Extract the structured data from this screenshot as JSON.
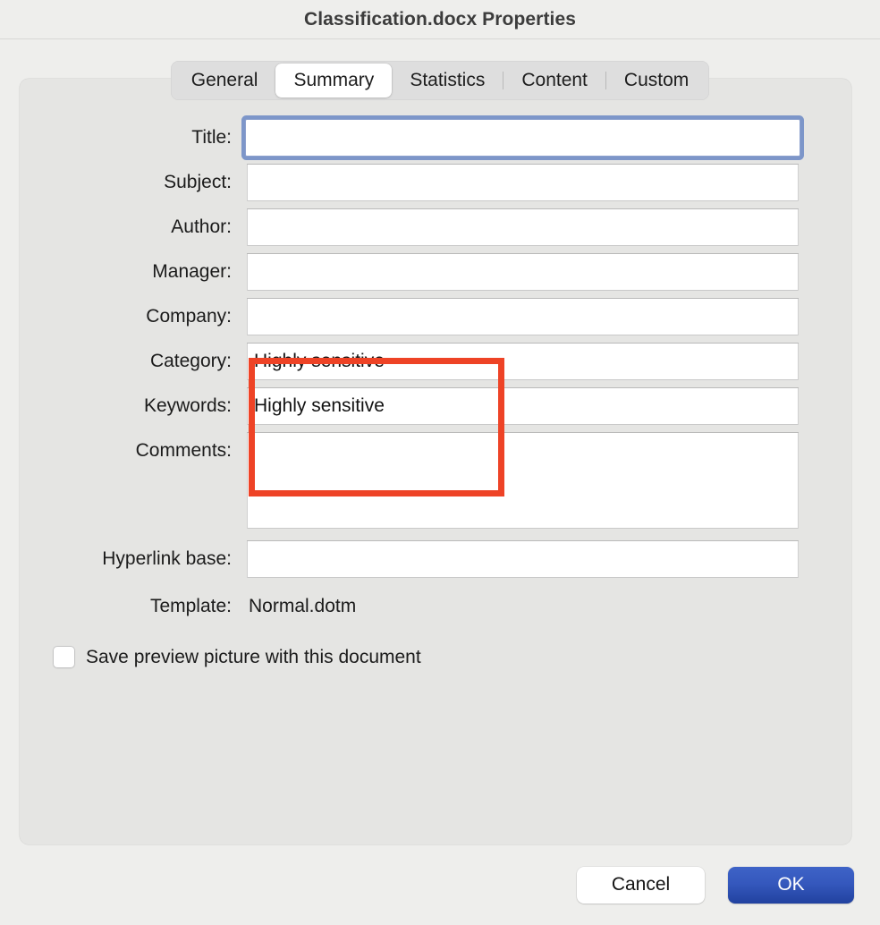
{
  "window": {
    "title": "Classification.docx Properties"
  },
  "tabs": [
    {
      "label": "General",
      "active": false
    },
    {
      "label": "Summary",
      "active": true
    },
    {
      "label": "Statistics",
      "active": false
    },
    {
      "label": "Content",
      "active": false
    },
    {
      "label": "Custom",
      "active": false
    }
  ],
  "summary": {
    "title": {
      "label": "Title:",
      "value": "",
      "placeholder": ""
    },
    "subject": {
      "label": "Subject:",
      "value": "",
      "placeholder": ""
    },
    "author": {
      "label": "Author:",
      "value": "",
      "placeholder": ""
    },
    "manager": {
      "label": "Manager:",
      "value": "",
      "placeholder": ""
    },
    "company": {
      "label": "Company:",
      "value": "",
      "placeholder": ""
    },
    "category": {
      "label": "Category:",
      "value": "Highly sensitive",
      "placeholder": ""
    },
    "keywords": {
      "label": "Keywords:",
      "value": "Highly sensitive",
      "placeholder": ""
    },
    "comments": {
      "label": "Comments:",
      "value": "",
      "placeholder": ""
    },
    "hyperlink_base": {
      "label": "Hyperlink base:",
      "value": "",
      "placeholder": ""
    },
    "template": {
      "label": "Template:",
      "value": "Normal.dotm"
    },
    "save_preview": {
      "label": "Save preview picture with this document",
      "checked": false
    }
  },
  "footer": {
    "cancel_label": "Cancel",
    "ok_label": "OK"
  },
  "annotation": {
    "color": "#ee4326",
    "name": "highlight-rectangle"
  },
  "colors": {
    "window_background": "#eeeeec",
    "panel_background": "#e5e5e3",
    "tabbar_background": "#dedede",
    "focus_ring": "#7d96c9",
    "ok_button": "#3558bd",
    "annotation_red": "#ee4326",
    "text": "#1b1b1b"
  }
}
